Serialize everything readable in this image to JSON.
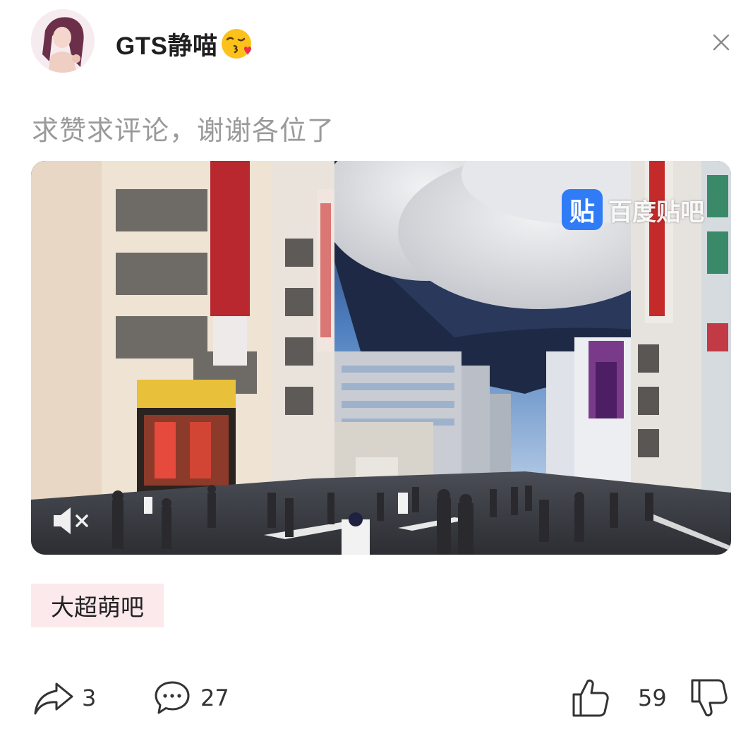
{
  "header": {
    "username": "GTS静喵",
    "username_emoji": "face-blowing-a-kiss-emoji"
  },
  "post": {
    "text": "求赞求评论，谢谢各位了"
  },
  "video": {
    "watermark_logo": "贴",
    "watermark_text": "百度贴吧",
    "muted": true
  },
  "tag": {
    "label": "大超萌吧"
  },
  "actions": {
    "share_count": "3",
    "comment_count": "27",
    "like_count": "59"
  },
  "colors": {
    "tag_bg": "#fbe9ec",
    "watermark_blue": "#2f7cf6",
    "muted_text": "#9a9a9a"
  }
}
